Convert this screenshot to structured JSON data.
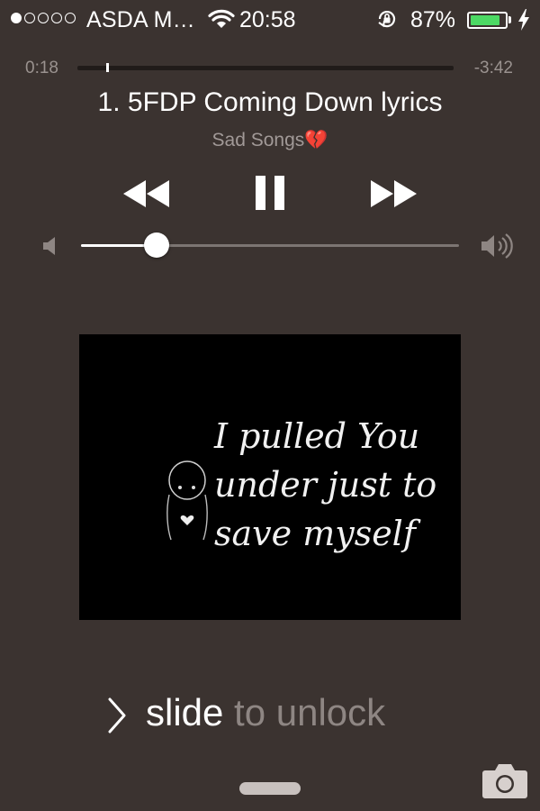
{
  "status_bar": {
    "signal_strength_of_5": 1,
    "carrier": "ASDA M…",
    "time": "20:58",
    "battery_percent": "87%",
    "battery_level": 0.87,
    "battery_color": "#4cd964",
    "icons": [
      "signal-dots-icon",
      "wifi-icon",
      "orientation-lock-icon",
      "battery-icon",
      "charging-bolt-icon"
    ]
  },
  "now_playing": {
    "elapsed": "0:18",
    "remaining": "-3:42",
    "progress": 0.076,
    "title": "1. 5FDP Coming Down lyrics",
    "artist": "Sad Songs💔",
    "controls": [
      "rewind-icon",
      "pause-icon",
      "fast-forward-icon"
    ],
    "volume": 0.2
  },
  "artwork": {
    "lines": [
      "I pulled You",
      "under just to",
      "save myself"
    ]
  },
  "lock_screen": {
    "slide_word": "slide",
    "rest_text": " to unlock",
    "icons": [
      "chevron-right-icon",
      "camera-icon",
      "grabber-handle"
    ]
  }
}
